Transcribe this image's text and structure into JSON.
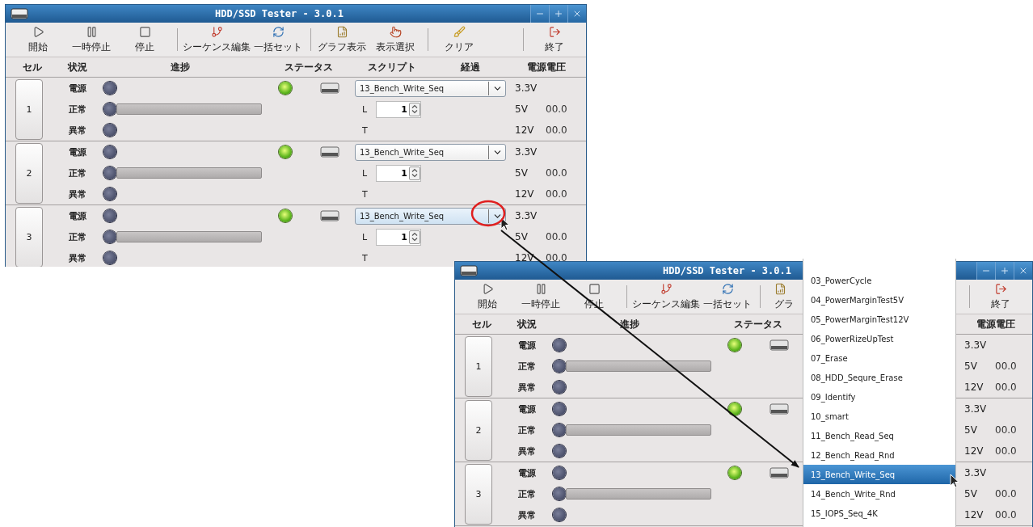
{
  "windows": [
    {
      "title": "HDD/SSD Tester - 3.0.1",
      "toolbar": [
        {
          "items": [
            {
              "kind": "play",
              "label": "開始"
            },
            {
              "kind": "pause",
              "label": "一時停止"
            },
            {
              "kind": "stop",
              "label": "停止"
            }
          ]
        },
        {
          "items": [
            {
              "kind": "sequence",
              "label": "シーケンス編集"
            },
            {
              "kind": "refresh",
              "label": "一括セット"
            }
          ]
        },
        {
          "items": [
            {
              "kind": "graph",
              "label": "グラフ表示"
            },
            {
              "kind": "select",
              "label": "表示選択"
            }
          ]
        },
        {
          "items": [
            {
              "kind": "broom",
              "label": "クリア"
            }
          ]
        },
        {
          "items": [
            {
              "kind": "exit",
              "label": "終了"
            }
          ]
        }
      ],
      "columns": [
        {
          "kind": "cell",
          "label": "セル"
        },
        {
          "kind": "status",
          "label": "状況"
        },
        {
          "kind": "progress",
          "label": "進捗"
        },
        {
          "kind": "state",
          "label": "ステータス"
        },
        {
          "kind": "script",
          "label": "スクリプト"
        },
        {
          "kind": "elapsed",
          "label": "経過"
        },
        {
          "kind": "voltage",
          "label": "電源電圧"
        }
      ],
      "cells": [
        {
          "number": "1",
          "lamps": [
            {
              "label": "電源",
              "on": false
            },
            {
              "label": "正常",
              "on": false
            },
            {
              "label": "異常",
              "on": false
            }
          ],
          "progress": {
            "level": 0
          },
          "status_led": {
            "on": true
          },
          "script": {
            "value": "13_Bench_Write_Seq",
            "focused": false
          },
          "loop": {
            "label": "L",
            "value": "1"
          },
          "timer_label": "T",
          "voltages": [
            {
              "label": "3.3V"
            },
            {
              "label": "5V",
              "value": "00.0"
            },
            {
              "label": "12V",
              "value": "00.0"
            }
          ]
        },
        {
          "number": "2",
          "lamps": [
            {
              "label": "電源",
              "on": false
            },
            {
              "label": "正常",
              "on": false
            },
            {
              "label": "異常",
              "on": false
            }
          ],
          "progress": {
            "level": 0
          },
          "status_led": {
            "on": true
          },
          "script": {
            "value": "13_Bench_Write_Seq",
            "focused": false
          },
          "loop": {
            "label": "L",
            "value": "1"
          },
          "timer_label": "T",
          "voltages": [
            {
              "label": "3.3V"
            },
            {
              "label": "5V",
              "value": "00.0"
            },
            {
              "label": "12V",
              "value": "00.0"
            }
          ]
        },
        {
          "number": "3",
          "lamps": [
            {
              "label": "電源",
              "on": false
            },
            {
              "label": "正常",
              "on": false
            },
            {
              "label": "異常",
              "on": false
            }
          ],
          "progress": {
            "level": 0
          },
          "status_led": {
            "on": true
          },
          "script": {
            "value": "13_Bench_Write_Seq",
            "focused": true
          },
          "loop": {
            "label": "L",
            "value": "1"
          },
          "timer_label": "T",
          "voltages": [
            {
              "label": "3.3V"
            },
            {
              "label": "5V",
              "value": "00.0"
            },
            {
              "label": "12V",
              "value": "00.0"
            }
          ]
        }
      ]
    },
    {
      "title": "HDD/SSD Tester - 3.0.1",
      "toolbar": [
        {
          "items": [
            {
              "kind": "play",
              "label": "開始"
            },
            {
              "kind": "pause",
              "label": "一時停止"
            },
            {
              "kind": "stop",
              "label": "停止"
            }
          ]
        },
        {
          "items": [
            {
              "kind": "sequence",
              "label": "シーケンス編集"
            },
            {
              "kind": "refresh",
              "label": "一括セット"
            }
          ]
        },
        {
          "items": [
            {
              "kind": "graph",
              "label": "グラ",
              "clipped": true
            }
          ]
        },
        {
          "items": [
            {
              "kind": "exit",
              "label": "終了"
            }
          ]
        }
      ],
      "columns": [
        {
          "kind": "cell",
          "label": "セル"
        },
        {
          "kind": "status",
          "label": "状況"
        },
        {
          "kind": "progress",
          "label": "進捗"
        },
        {
          "kind": "state",
          "label": "ステータス"
        },
        {
          "kind": "voltage",
          "label": "電源電圧"
        }
      ],
      "cells": [
        {
          "number": "1",
          "lamps": [
            {
              "label": "電源",
              "on": false
            },
            {
              "label": "正常",
              "on": false
            },
            {
              "label": "異常",
              "on": false
            }
          ],
          "progress": {
            "level": 0
          },
          "status_led": {
            "on": true
          },
          "voltages": [
            {
              "label": "3.3V"
            },
            {
              "label": "5V",
              "value": "00.0"
            },
            {
              "label": "12V",
              "value": "00.0"
            }
          ]
        },
        {
          "number": "2",
          "lamps": [
            {
              "label": "電源",
              "on": false
            },
            {
              "label": "正常",
              "on": false
            },
            {
              "label": "異常",
              "on": false
            }
          ],
          "progress": {
            "level": 0
          },
          "status_led": {
            "on": true
          },
          "voltages": [
            {
              "label": "3.3V"
            },
            {
              "label": "5V",
              "value": "00.0"
            },
            {
              "label": "12V",
              "value": "00.0"
            }
          ]
        },
        {
          "number": "3",
          "lamps": [
            {
              "label": "電源",
              "on": false
            },
            {
              "label": "正常",
              "on": false
            },
            {
              "label": "異常",
              "on": false
            }
          ],
          "progress": {
            "level": 0
          },
          "status_led": {
            "on": true
          },
          "voltages": [
            {
              "label": "3.3V"
            },
            {
              "label": "5V",
              "value": "00.0"
            },
            {
              "label": "12V",
              "value": "00.0"
            }
          ]
        }
      ]
    }
  ],
  "script_dropdown": {
    "items": [
      {
        "label": "03_PowerCycle",
        "selected": false
      },
      {
        "label": "04_PowerMarginTest5V",
        "selected": false
      },
      {
        "label": "05_PowerMarginTest12V",
        "selected": false
      },
      {
        "label": "06_PowerRizeUpTest",
        "selected": false
      },
      {
        "label": "07_Erase",
        "selected": false
      },
      {
        "label": "08_HDD_Sequre_Erase",
        "selected": false
      },
      {
        "label": "09_Identify",
        "selected": false
      },
      {
        "label": "10_smart",
        "selected": false
      },
      {
        "label": "11_Bench_Read_Seq",
        "selected": false
      },
      {
        "label": "12_Bench_Read_Rnd",
        "selected": false
      },
      {
        "label": "13_Bench_Write_Seq",
        "selected": true
      },
      {
        "label": "14_Bench_Write_Rnd",
        "selected": false
      },
      {
        "label": "15_IOPS_Seq_4K",
        "selected": false
      }
    ]
  }
}
